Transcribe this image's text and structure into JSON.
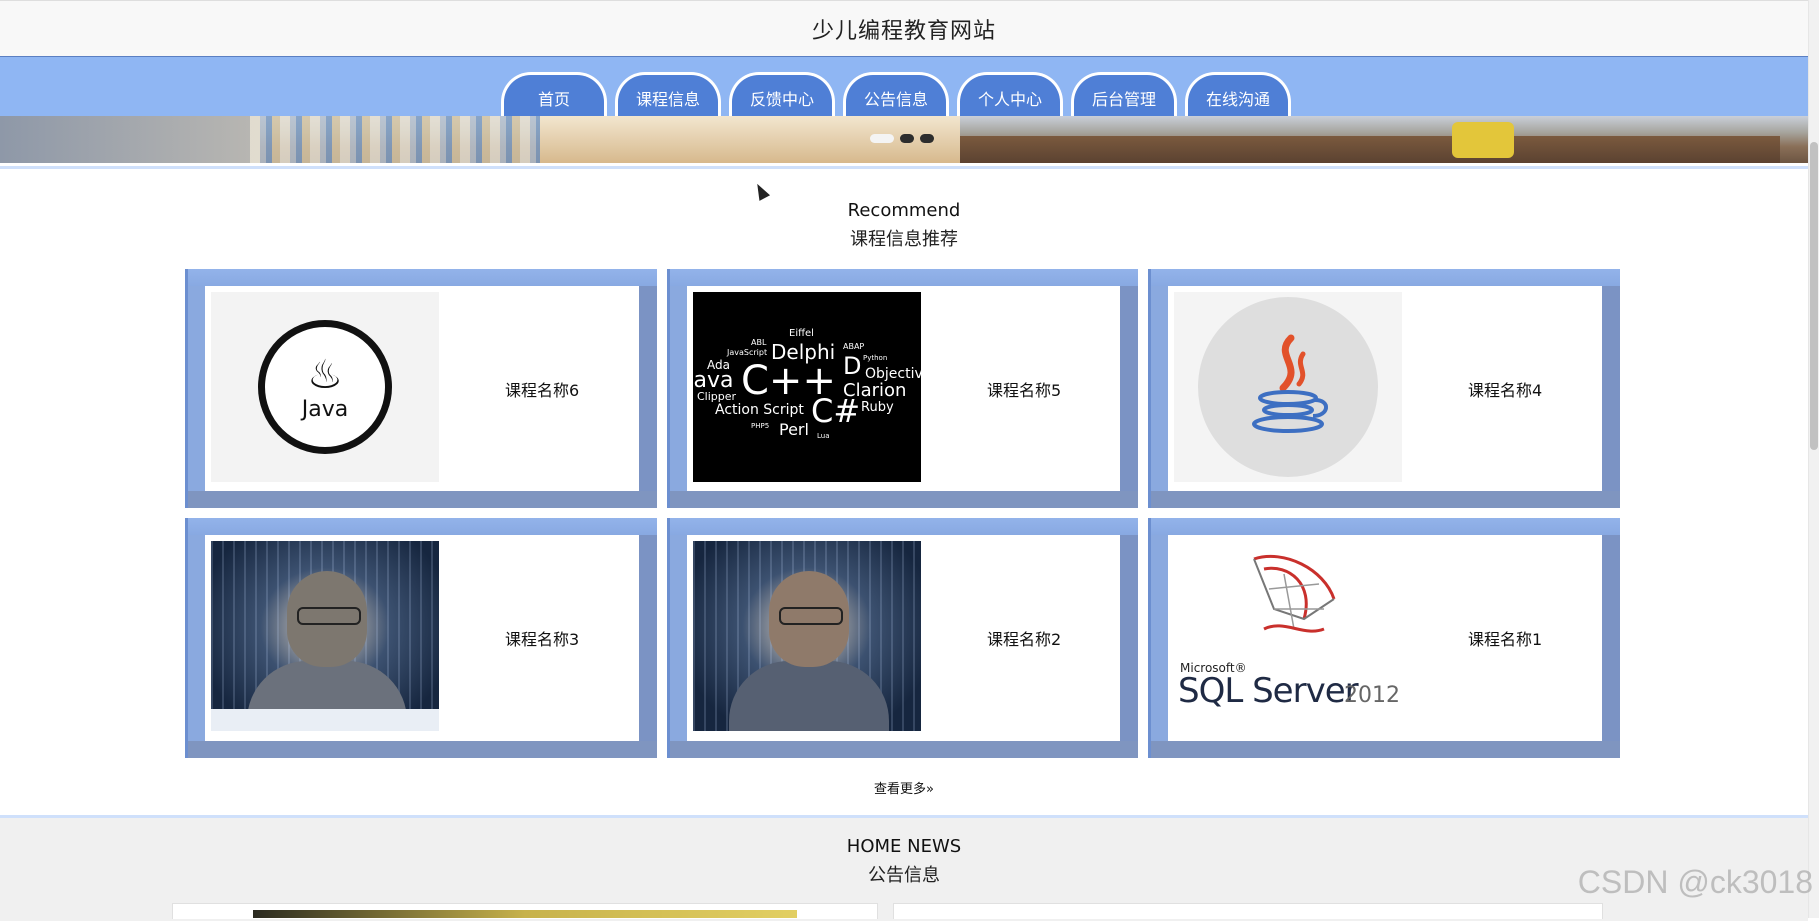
{
  "header": {
    "title": "少儿编程教育网站"
  },
  "nav": {
    "items": [
      "首页",
      "课程信息",
      "反馈中心",
      "公告信息",
      "个人中心",
      "后台管理",
      "在线沟通"
    ]
  },
  "banner": {
    "slides": 3,
    "active_slide": 1
  },
  "recommend": {
    "en": "Recommend",
    "zh": "课程信息推荐",
    "cards": [
      {
        "label": "课程名称6",
        "image": "java-logo"
      },
      {
        "label": "课程名称5",
        "image": "programming-languages-wordcloud"
      },
      {
        "label": "课程名称4",
        "image": "java-cup-logo"
      },
      {
        "label": "课程名称3",
        "image": "hacker-hoodie-photo"
      },
      {
        "label": "课程名称2",
        "image": "programmer-photo"
      },
      {
        "label": "课程名称1",
        "image": "sql-server-2012-logo"
      }
    ],
    "more": "查看更多»"
  },
  "thumb_text": {
    "java_word": "Java",
    "lang_cloud": [
      "Eiffel",
      "ABL",
      "JavaScript",
      "Delphi",
      "ABAP",
      "Ada",
      "D",
      "Python",
      "Objective",
      "C++",
      "Java",
      "Clarion",
      "Clipper",
      "C#",
      "Ruby",
      "Action Script",
      "PHP5",
      "Perl",
      "Lua"
    ],
    "sql_ms": "Microsoft®",
    "sql_name": "SQL Server",
    "sql_year": "2012"
  },
  "news": {
    "en": "HOME NEWS",
    "zh": "公告信息"
  },
  "watermark": "CSDN @ck3018",
  "colors": {
    "nav_bg": "#8fb6f3",
    "nav_tab": "#4f7fd6",
    "card_frame": "#8fb0e6"
  }
}
